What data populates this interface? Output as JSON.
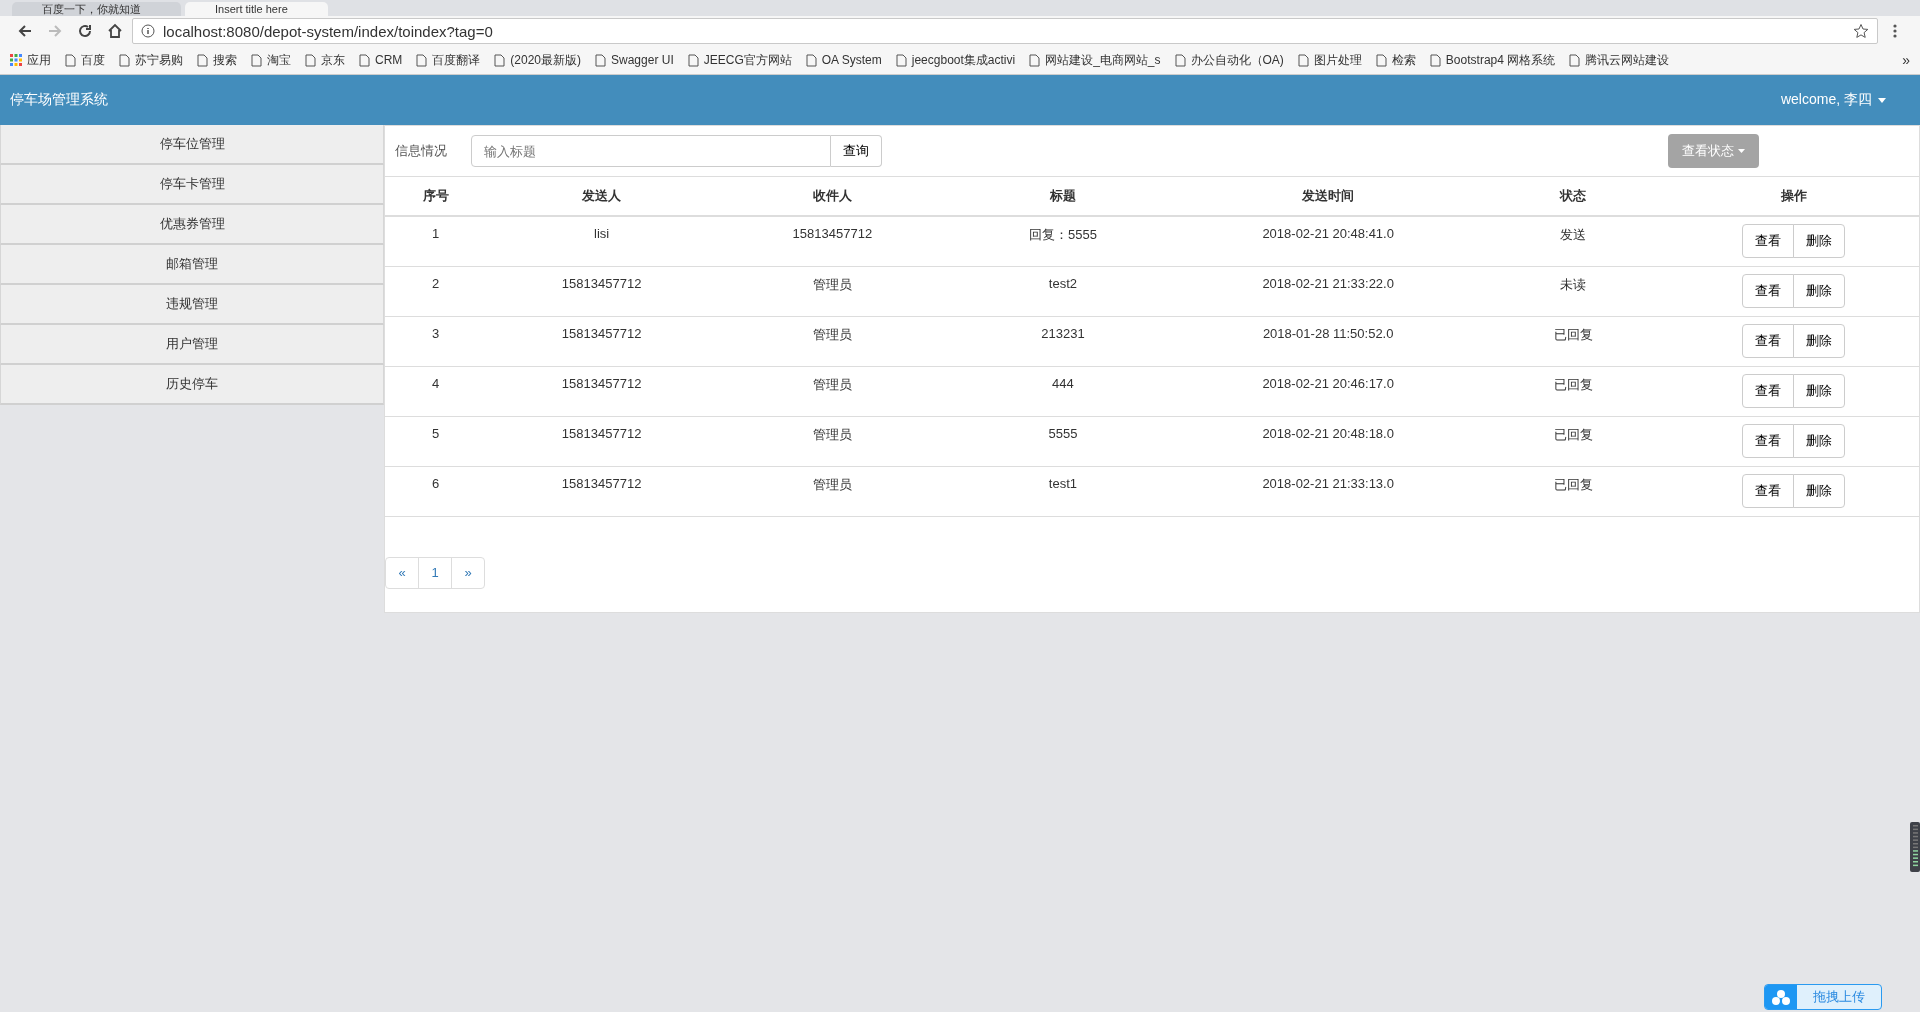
{
  "browser": {
    "tabs": [
      {
        "title": "百度一下，你就知道",
        "selected": false
      },
      {
        "title": "Insert title here",
        "selected": true
      }
    ],
    "url": "localhost:8080/depot-system/index/toindex?tag=0",
    "bookmarks": [
      "应用",
      "百度",
      "苏宁易购",
      "搜索",
      "淘宝",
      "京东",
      "CRM",
      "百度翻译",
      "(2020最新版)",
      "Swagger UI",
      "JEECG官方网站",
      "OA System",
      "jeecgboot集成activi",
      "网站建设_电商网站_s",
      "办公自动化（OA)",
      "图片处理",
      "检索",
      "Bootstrap4 网格系统",
      "腾讯云网站建设"
    ],
    "more": "»"
  },
  "header": {
    "title": "停车场管理系统",
    "user": "welcome, 李四"
  },
  "sidebar": {
    "items": [
      {
        "label": "停车位管理",
        "selected": false
      },
      {
        "label": "停车卡管理",
        "selected": false
      },
      {
        "label": "优惠券管理",
        "selected": false
      },
      {
        "label": "邮箱管理",
        "selected": false
      },
      {
        "label": "违规管理",
        "selected": false
      },
      {
        "label": "用户管理",
        "selected": false
      },
      {
        "label": "历史停车",
        "selected": false
      }
    ]
  },
  "toolbar": {
    "label": "信息情况",
    "search": {
      "placeholder": "输入标题"
    },
    "search_button": "查询",
    "status_button": "查看状态"
  },
  "table": {
    "columns": [
      "序号",
      "发送人",
      "收件人",
      "标题",
      "发送时间",
      "状态",
      "操作"
    ],
    "rows": [
      {
        "cells": [
          "1",
          "lisi",
          "15813457712",
          "回复：5555",
          "2018-02-21 20:48:41.0",
          "发送"
        ],
        "actions": [
          "查看",
          "删除"
        ]
      },
      {
        "cells": [
          "2",
          "15813457712",
          "管理员",
          "test2",
          "2018-02-21 21:33:22.0",
          "未读"
        ],
        "actions": [
          "查看",
          "删除"
        ]
      },
      {
        "cells": [
          "3",
          "15813457712",
          "管理员",
          "213231",
          "2018-01-28 11:50:52.0",
          "已回复"
        ],
        "actions": [
          "查看",
          "删除"
        ]
      },
      {
        "cells": [
          "4",
          "15813457712",
          "管理员",
          "444",
          "2018-02-21 20:46:17.0",
          "已回复"
        ],
        "actions": [
          "查看",
          "删除"
        ]
      },
      {
        "cells": [
          "5",
          "15813457712",
          "管理员",
          "5555",
          "2018-02-21 20:48:18.0",
          "已回复"
        ],
        "actions": [
          "查看",
          "删除"
        ]
      },
      {
        "cells": [
          "6",
          "15813457712",
          "管理员",
          "test1",
          "2018-02-21 21:33:13.0",
          "已回复"
        ],
        "actions": [
          "查看",
          "删除"
        ]
      }
    ]
  },
  "pagination": [
    {
      "label": "«",
      "selected": false
    },
    {
      "label": "1",
      "selected": false
    },
    {
      "label": "»",
      "selected": false
    }
  ],
  "upload_widget": {
    "label": "拖拽上传"
  }
}
